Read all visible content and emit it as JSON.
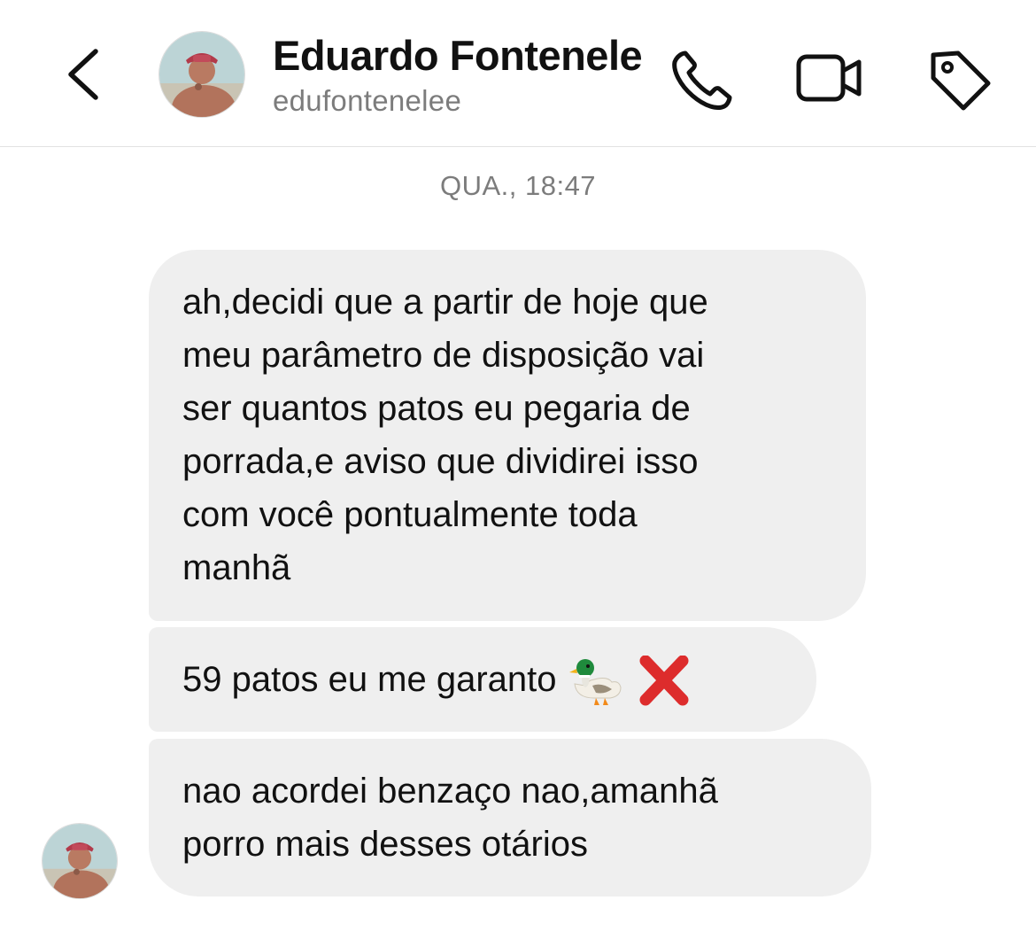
{
  "header": {
    "name": "Eduardo Fontenele",
    "handle": "edufontenelee",
    "icons": {
      "back": "chevron-left-icon",
      "call": "phone-icon",
      "video": "video-camera-icon",
      "tag": "tag-icon"
    }
  },
  "conversation": {
    "timestamp": "QUA., 18:47",
    "messages": [
      {
        "lines": [
          "ah,decidi que a partir de hoje que",
          "meu parâmetro de disposição vai",
          "ser quantos patos eu pegaria de",
          "porrada,e aviso que dividirei isso",
          "com você pontualmente toda",
          "manhã"
        ]
      },
      {
        "text": "59 patos eu me garanto",
        "emojis": [
          "duck-emoji",
          "cross-mark-emoji"
        ]
      },
      {
        "lines": [
          "nao acordei benzaço nao,amanhã",
          "porro mais desses otários"
        ]
      }
    ]
  },
  "colors": {
    "bubble": "#efefef",
    "text": "#111111",
    "secondary_text": "#7c7c7c",
    "divider": "#e2e2e2",
    "cross_red": "#dd2c2c"
  }
}
